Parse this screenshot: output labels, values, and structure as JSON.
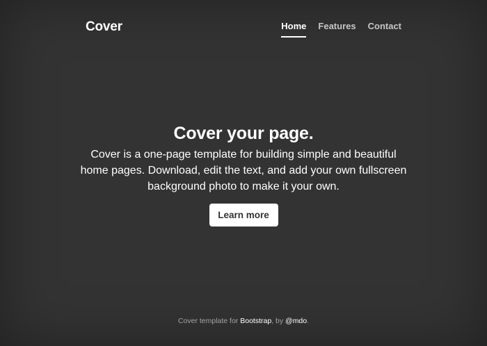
{
  "masthead": {
    "brand": "Cover",
    "nav": [
      {
        "label": "Home",
        "active": true
      },
      {
        "label": "Features",
        "active": false
      },
      {
        "label": "Contact",
        "active": false
      }
    ]
  },
  "cover": {
    "heading": "Cover your page.",
    "lead": "Cover is a one-page template for building simple and beautiful home pages. Download, edit the text, and add your own fullscreen background photo to make it your own.",
    "button_label": "Learn more"
  },
  "footer": {
    "prefix": "Cover template for ",
    "bootstrap_link": "Bootstrap",
    "middle": ", by ",
    "author_link": "@mdo",
    "suffix": "."
  },
  "colors": {
    "background": "#333333",
    "text": "#ffffff",
    "button_text": "#333333"
  }
}
